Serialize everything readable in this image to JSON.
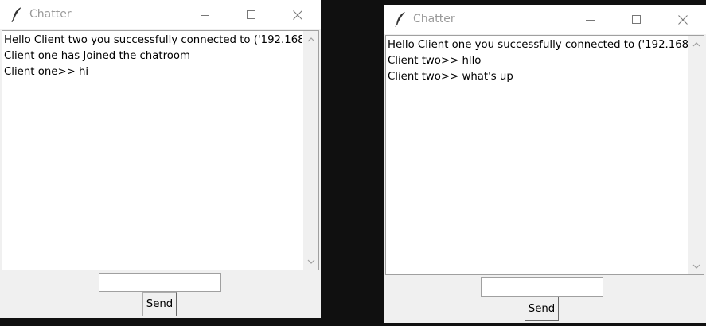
{
  "windows": [
    {
      "title": "Chatter",
      "icon": "feather-icon",
      "messages": [
        "Hello Client two you successfully connected to ('192.168.",
        "Client one has Joined the chatroom",
        "Client one>>  hi"
      ],
      "input_value": "",
      "send_label": "Send"
    },
    {
      "title": "Chatter",
      "icon": "feather-icon",
      "messages": [
        "Hello Client one you successfully connected to ('192.168.",
        "Client two>>  hllo",
        "Client two>>  what's up"
      ],
      "input_value": "",
      "send_label": "Send"
    }
  ],
  "colors": {
    "desktop": "#101010",
    "window_bg": "#f0f0f0",
    "titlebar_bg": "#ffffff",
    "title_text": "#9a9a9a"
  }
}
